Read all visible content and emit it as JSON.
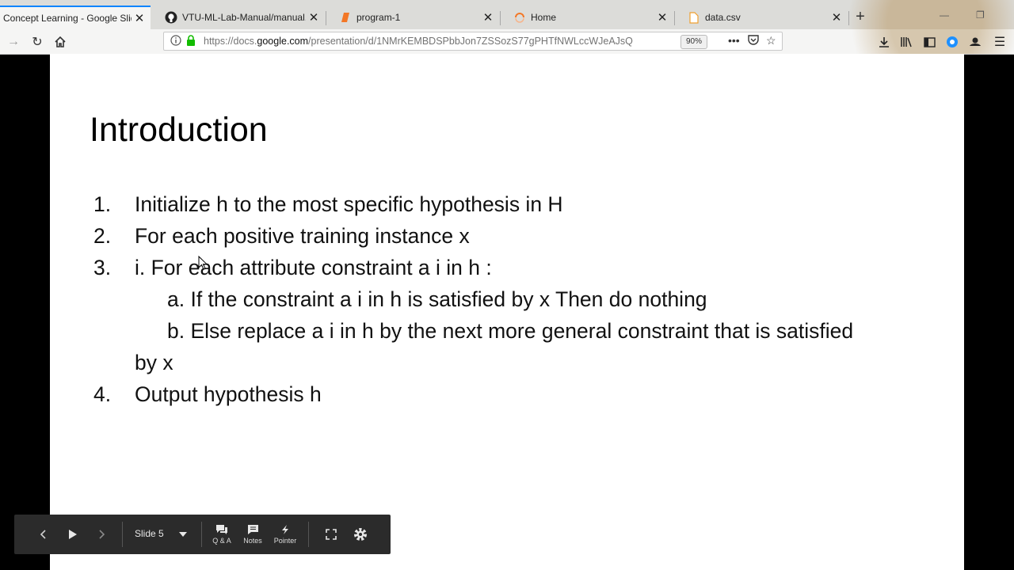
{
  "browser": {
    "tabs": [
      {
        "label": "Concept Learning - Google Slid",
        "active": true,
        "icon": "google-slides-icon"
      },
      {
        "label": "VTU-ML-Lab-Manual/manual.p",
        "active": false,
        "icon": "github-icon"
      },
      {
        "label": "program-1",
        "active": false,
        "icon": "jupyter-notebook-icon"
      },
      {
        "label": "Home",
        "active": false,
        "icon": "jupyter-loading-icon"
      },
      {
        "label": "data.csv",
        "active": false,
        "icon": "file-icon"
      }
    ],
    "url_prefix": "https://docs.",
    "url_domain": "google.com",
    "url_rest": "/presentation/d/1NMrKEMBDSPbbJon7ZSSozS77gPHTfNWLccWJeAJsQ",
    "zoom": "90%",
    "accent_color": "#0a84ff"
  },
  "slide": {
    "title": "Introduction",
    "items": [
      {
        "num": "1.",
        "text": "Initialize h to the most specific hypothesis in H"
      },
      {
        "num": "2.",
        "text": "For each positive training instance x"
      },
      {
        "num": "3.",
        "text": "i. For each attribute constraint a i in h :"
      },
      {
        "num": "",
        "text": "a. If the constraint a i in h is satisfied by x Then do nothing"
      },
      {
        "num": "",
        "text": "b. Else replace a i in h by the next more general constraint that is satisfied"
      },
      {
        "num": "",
        "text": "by x"
      },
      {
        "num": "4.",
        "text": "Output hypothesis h"
      }
    ]
  },
  "toolbar": {
    "slide_label": "Slide 5",
    "qa_label": "Q & A",
    "notes_label": "Notes",
    "pointer_label": "Pointer"
  }
}
